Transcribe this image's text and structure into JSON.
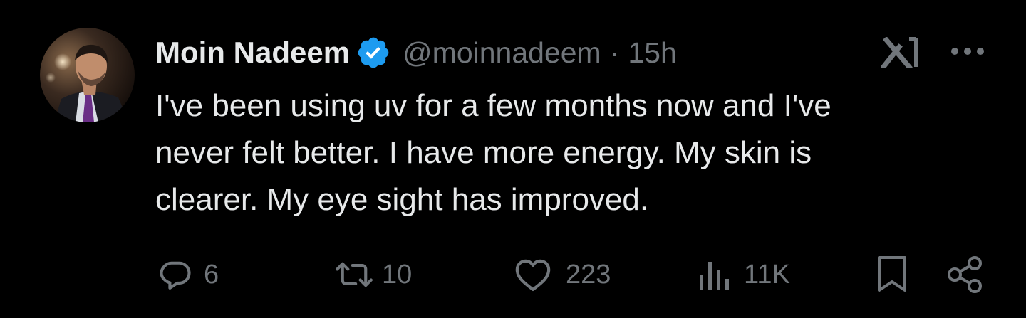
{
  "author": {
    "display_name": "Moin Nadeem",
    "handle": "@moinnadeem",
    "separator": "·",
    "timestamp": "15h",
    "verified_icon": "verified-badge-icon",
    "verified_color": "#1d9bf0"
  },
  "tweet": {
    "text_lines": [
      "I've been using uv for a few months now and I've",
      "never felt better. I have more energy. My skin is",
      "clearer. My eye sight has improved."
    ]
  },
  "header_icons": {
    "grok": "grok-icon",
    "more": "more-icon"
  },
  "actions": {
    "reply": {
      "icon": "reply-icon",
      "count": "6"
    },
    "repost": {
      "icon": "repost-icon",
      "count": "10"
    },
    "like": {
      "icon": "like-icon",
      "count": "223"
    },
    "views": {
      "icon": "views-icon",
      "count": "11K"
    },
    "bookmark": {
      "icon": "bookmark-icon"
    },
    "share": {
      "icon": "share-icon"
    }
  },
  "colors": {
    "background": "#000000",
    "text_primary": "#e7e9ea",
    "text_secondary": "#71767b",
    "accent": "#1d9bf0"
  }
}
